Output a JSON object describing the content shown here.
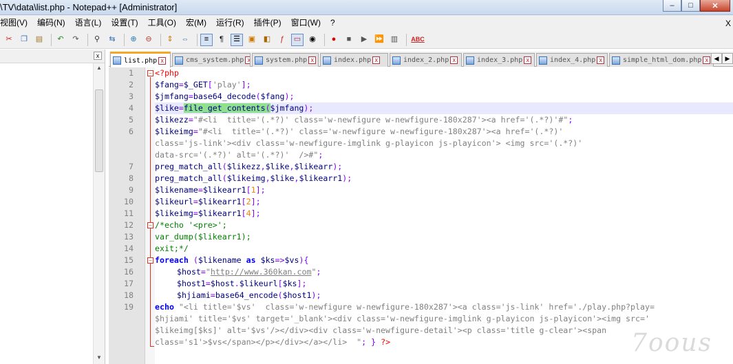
{
  "window": {
    "title": "\\TV\\data\\list.php - Notepad++ [Administrator]",
    "minimize_label": "‒",
    "maximize_label": "□",
    "close_label": "✕"
  },
  "menu": {
    "items": [
      "视图(V)",
      "编码(N)",
      "语言(L)",
      "设置(T)",
      "工具(O)",
      "宏(M)",
      "运行(R)",
      "插件(P)",
      "窗口(W)",
      "?"
    ],
    "close_label": "X"
  },
  "toolbar": {
    "icons": [
      "cut-icon",
      "copy-icon",
      "paste-icon",
      "undo-icon",
      "redo-icon",
      "find-icon",
      "replace-icon",
      "zoom-in-icon",
      "zoom-out-icon",
      "sync-v-icon",
      "sync-h-icon",
      "wrap-icon",
      "all-chars-icon",
      "indent-guide-icon",
      "udl-icon",
      "doc-map-icon",
      "function-list-icon",
      "folder-workspace-icon",
      "monitor-icon",
      "record-icon",
      "stop-icon",
      "play-icon",
      "play-multi-icon",
      "save-macro-icon",
      "spellcheck-icon"
    ],
    "spellcheck_label": "ABC"
  },
  "leftpanel": {
    "close_label": "x"
  },
  "tabs": [
    {
      "label": "list.php",
      "active": true
    },
    {
      "label": "cms_system.php",
      "active": false
    },
    {
      "label": "system.php",
      "active": false
    },
    {
      "label": "index.php",
      "active": false
    },
    {
      "label": "index_2.php",
      "active": false
    },
    {
      "label": "index_3.php",
      "active": false
    },
    {
      "label": "index_4.php",
      "active": false
    },
    {
      "label": "simple_html_dom.php",
      "active": false
    }
  ],
  "tab_close_label": "x",
  "line_numbers": [
    "1",
    "2",
    "3",
    "4",
    "5",
    "6",
    "",
    "",
    "7",
    "8",
    "9",
    "10",
    "11",
    "12",
    "13",
    "14",
    "15",
    "16",
    "17",
    "18",
    "19",
    "",
    "",
    ""
  ],
  "code": {
    "l1_open": "<?php",
    "l2_var": "$fang",
    "l2_eq": "=",
    "l2_get": "$_GET",
    "l2_br1": "[",
    "l2_str": "'play'",
    "l2_end": "];",
    "l3_var": "$jmfang",
    "l3_eq": "=",
    "l3_fn": "base64_decode",
    "l3_p1": "(",
    "l3_arg": "$fang",
    "l3_end": ");",
    "l4_var": "$like",
    "l4_eq": "=",
    "l4_fn": "file_get_contents",
    "l4_p1": "(",
    "l4_arg": "$jmfang",
    "l4_end": ");",
    "l5_var": "$likezz",
    "l5_eq": "=",
    "l5_str": "\"#<li  title='(.*?)' class='w-newfigure w-newfigure-180x287'><a href='(.*?)'#\"",
    "l5_end": ";",
    "l6_var": "$likeimg",
    "l6_eq": "=",
    "l6_str_a": "\"#<li  title='(.*?)' class='w-newfigure w-newfigure-180x287'><a href='(.*?)'",
    "l6_str_b": "class='js-link'><div class='w-newfigure-imglink g-playicon js-playicon'> <img src='(.*?)'",
    "l6_str_c": "data-src='(.*?)' alt='(.*?)'  />#\"",
    "l6_end": ";",
    "l7_fn": "preg_match_all",
    "l7_p1": "(",
    "l7_a1": "$likezz",
    "l7_c1": ",",
    "l7_a2": "$like",
    "l7_c2": ",",
    "l7_a3": "$likearr",
    "l7_end": ");",
    "l8_fn": "preg_match_all",
    "l8_p1": "(",
    "l8_a1": "$likeimg",
    "l8_c1": ",",
    "l8_a2": "$like",
    "l8_c2": ",",
    "l8_a3": "$likearr1",
    "l8_end": ");",
    "l9_var": "$likename",
    "l9_eq": "=",
    "l9_arr": "$likearr1",
    "l9_b1": "[",
    "l9_n": "1",
    "l9_end": "];",
    "l10_var": "$likeurl",
    "l10_eq": "=",
    "l10_arr": "$likearr1",
    "l10_b1": "[",
    "l10_n": "2",
    "l10_end": "];",
    "l11_var": "$likeimg",
    "l11_eq": "=",
    "l11_arr": "$likearr1",
    "l11_b1": "[",
    "l11_n": "4",
    "l11_end": "];",
    "l12": "/*echo '<pre>';",
    "l13": "var_dump($likearr1);",
    "l14": "exit;*/",
    "l15_kw": "foreach",
    "l15_p1": " (",
    "l15_a1": "$likename",
    "l15_as": " as ",
    "l15_a2": "$ks",
    "l15_arrow": "=>",
    "l15_a3": "$vs",
    "l15_end": "){",
    "l16_var": "$host",
    "l16_eq": "=",
    "l16_q1": "\"",
    "l16_url": "http://www.360kan.com",
    "l16_q2": "\"",
    "l16_end": ";",
    "l17_var": "$host1",
    "l17_eq": "=",
    "l17_a1": "$host",
    "l17_dot": ".",
    "l17_a2": "$likeurl",
    "l17_b1": "[",
    "l17_a3": "$ks",
    "l17_end": "];",
    "l18_var": "$hjiami",
    "l18_eq": "=",
    "l18_fn": "base64_encode",
    "l18_p1": "(",
    "l18_arg": "$host1",
    "l18_end": ");",
    "l19_kw": "echo",
    "l19_str_a": " \"<li title='$vs'  class='w-newfigure w-newfigure-180x287'><a class='js-link' href='./play.php?play=",
    "l19_str_b": "$hjiami' title='$vs' target='_blank'><div class='w-newfigure-imglink g-playicon js-playicon'><img src='",
    "l19_str_c": "$likeimg[$ks]' alt='$vs'/></div><div class='w-newfigure-detail'><p class='title g-clear'><span",
    "l19_str_d": "class='s1'>$vs</span></p></div></a></li>  \"",
    "l19_end": "; }",
    "l19_close": " ?>"
  },
  "watermark": "7oous",
  "colors": {
    "keyword": "#0000ff",
    "variable": "#000080",
    "string": "#808080",
    "operator": "#8000ff",
    "php_tag": "#ff0000",
    "number": "#ff8000",
    "comment": "#008000",
    "highlight": "#8fe08f",
    "current_line": "#e8e8ff",
    "tab_accent": "#f5a623"
  }
}
